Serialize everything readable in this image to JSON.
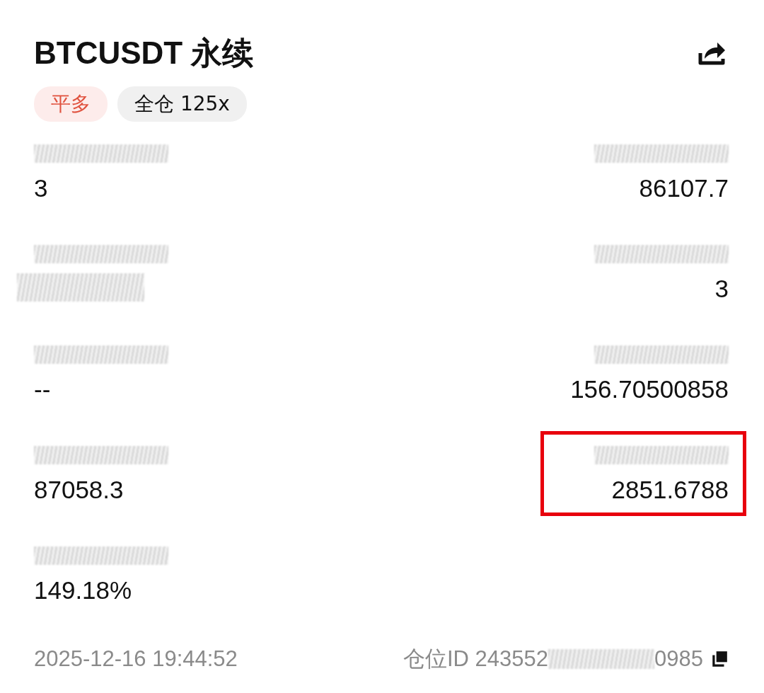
{
  "header": {
    "title": "BTCUSDT 永续"
  },
  "tags": [
    {
      "label": "平多",
      "kind": "side"
    },
    {
      "label": "全仓 125x",
      "kind": "margin"
    }
  ],
  "stats": [
    {
      "kind": "text",
      "value": "3",
      "highlighted": false
    },
    {
      "kind": "text",
      "value": "86107.7",
      "highlighted": false
    },
    {
      "kind": "redacted",
      "highlighted": false
    },
    {
      "kind": "text",
      "value": "3",
      "highlighted": false
    },
    {
      "kind": "text",
      "value": "--",
      "highlighted": false
    },
    {
      "kind": "text",
      "value": "156.70500858",
      "highlighted": false
    },
    {
      "kind": "text",
      "value": "87058.3",
      "highlighted": false
    },
    {
      "kind": "text",
      "value": "2851.6788",
      "highlighted": true
    },
    {
      "kind": "text",
      "value": "149.18%",
      "highlighted": false
    }
  ],
  "footer": {
    "time": "2025-12-16 19:44:52",
    "position_id_prefix": "仓位ID 243552",
    "position_id_suffix": "0985"
  }
}
